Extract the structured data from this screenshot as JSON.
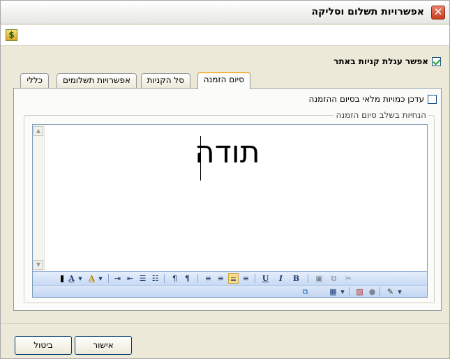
{
  "window": {
    "title": "אפשרויות תשלום וסליקה",
    "close_symbol": "✕"
  },
  "toolstrip": {
    "icon": "dollar-page-icon",
    "icon_glyph": "$"
  },
  "enable_cart": {
    "label": "אפשר עגלת קניות באתר",
    "checked": true
  },
  "tabs": [
    {
      "label": "כללי",
      "active": false
    },
    {
      "label": "אפשרויות תשלומים",
      "active": false
    },
    {
      "label": "סל הקניות",
      "active": false
    },
    {
      "label": "סיום הזמנה",
      "active": true
    }
  ],
  "order_end": {
    "update_stock_label": "עדכן כמויות מלאי בסיום ההזמנה",
    "update_stock_checked": false,
    "instructions_legend": "הנחיות בשלב סיום הזמנה",
    "editor_text": "תודה"
  },
  "toolbar1": {
    "bold": "B",
    "italic": "I",
    "underline": "U",
    "text_color": "A",
    "highlight": "A",
    "dropdown": "▾",
    "pilcrow_rtl": "¶",
    "pilcrow_ltr": "¶"
  },
  "buttons": {
    "ok": "אישור",
    "cancel": "ביטול"
  }
}
